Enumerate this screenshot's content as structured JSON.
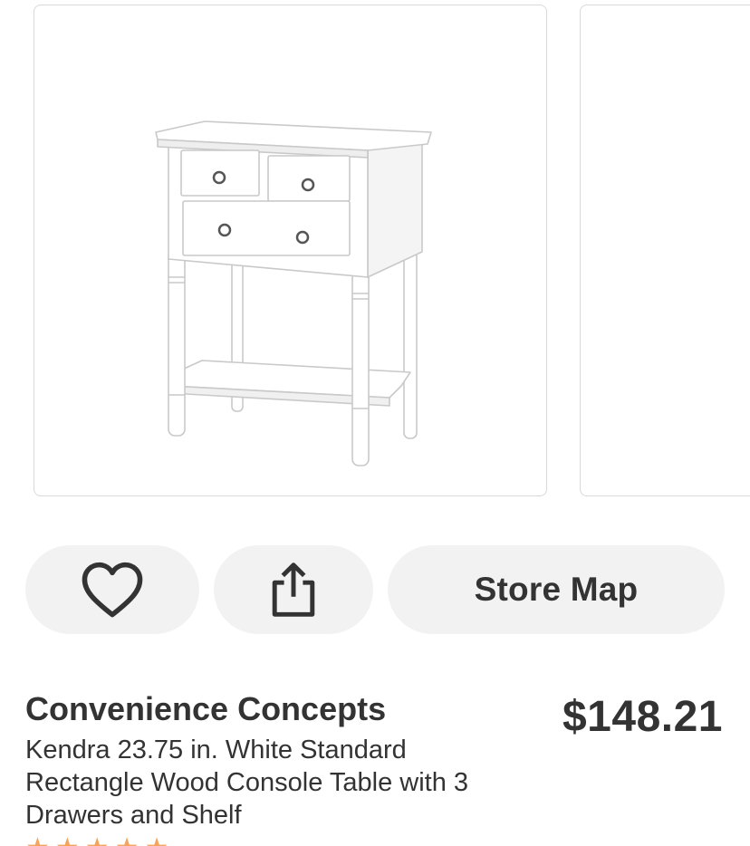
{
  "product": {
    "brand": "Convenience Concepts",
    "title": "Kendra 23.75 in. White Standard Rectangle Wood Console Table with 3 Drawers and Shelf",
    "price": "$148.21",
    "rating_stars": "★★★★★"
  },
  "actions": {
    "favorite_icon": "heart-outline-icon",
    "share_icon": "share-icon",
    "store_map_label": "Store Map"
  },
  "gallery": {
    "images": [
      "white-console-table-photo",
      "next-product-photo"
    ]
  },
  "colors": {
    "button_bg": "#f2f2f2",
    "text": "#333333",
    "card_border": "#d9d9d9",
    "star": "#f5a45d"
  }
}
